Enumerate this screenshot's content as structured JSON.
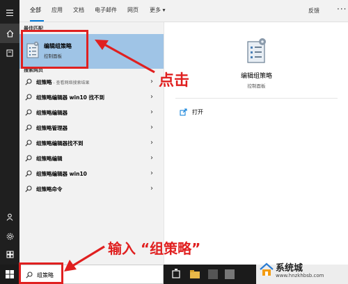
{
  "tabs": [
    {
      "label": "全部",
      "selected": true
    },
    {
      "label": "应用"
    },
    {
      "label": "文档"
    },
    {
      "label": "电子邮件"
    },
    {
      "label": "网页"
    },
    {
      "label": "更多 ▾"
    }
  ],
  "feedback_label": "反馈",
  "more_options": "···",
  "best_match": {
    "section_label": "最佳匹配",
    "title": "编辑组策略",
    "subtitle": "控制面板"
  },
  "web_search": {
    "section_label": "搜索网页",
    "items": [
      {
        "bold": "组策略",
        "sub": " - 查看网络搜索结果"
      },
      {
        "bold": "组策略编辑器 win10 找不到",
        "sub": ""
      },
      {
        "bold": "组策略编辑器",
        "sub": ""
      },
      {
        "bold": "组策略管理器",
        "sub": ""
      },
      {
        "bold": "组策略编辑器找不到",
        "sub": ""
      },
      {
        "bold": "组策略编辑",
        "sub": ""
      },
      {
        "bold": "组策略编辑器 win10",
        "sub": ""
      },
      {
        "bold": "组策略命令",
        "sub": ""
      }
    ]
  },
  "preview": {
    "title": "编辑组策略",
    "subtitle": "控制面板",
    "open_label": "打开"
  },
  "search_box": {
    "value": "组策略"
  },
  "annotations": {
    "click": "点击",
    "type": "输入 “组策略”"
  },
  "watermark": {
    "text": "系统城",
    "url": "www.hnzkhbsb.com"
  },
  "colors": {
    "highlight": "#9fc4e6",
    "annotation": "#e02020",
    "accent": "#0078d7"
  }
}
